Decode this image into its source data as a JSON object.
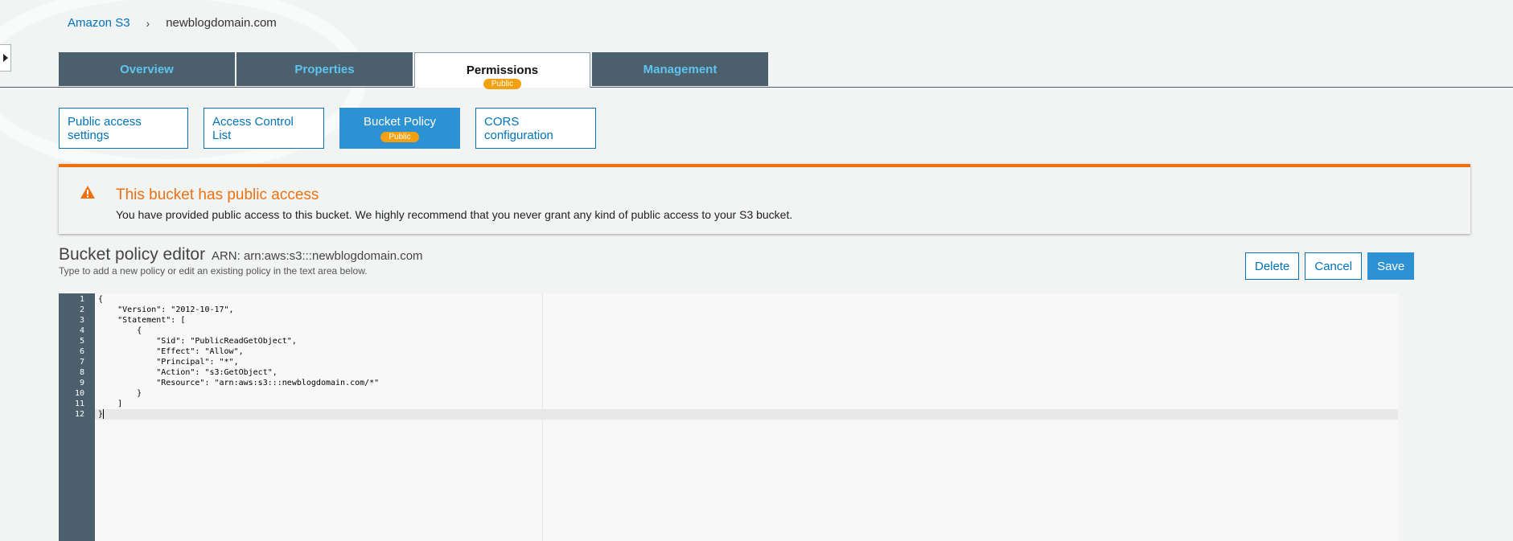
{
  "breadcrumb": {
    "root": "Amazon S3",
    "separator": "›",
    "current": "newblogdomain.com"
  },
  "tabs": [
    {
      "label": "Overview"
    },
    {
      "label": "Properties"
    },
    {
      "label": "Permissions",
      "badge": "Public"
    },
    {
      "label": "Management"
    }
  ],
  "subtabs": [
    {
      "label": "Public access settings"
    },
    {
      "label": "Access Control List"
    },
    {
      "label": "Bucket Policy",
      "badge": "Public"
    },
    {
      "label": "CORS configuration"
    }
  ],
  "alert": {
    "title": "This bucket has public access",
    "body": "You have provided public access to this bucket. We highly recommend that you never grant any kind of public access to your S3 bucket."
  },
  "editor": {
    "title": "Bucket policy editor",
    "arn": "ARN: arn:aws:s3:::newblogdomain.com",
    "hint": "Type to add a new policy or edit an existing policy in the text area below.",
    "line_numbers": [
      "1",
      "2",
      "3",
      "4",
      "5",
      "6",
      "7",
      "8",
      "9",
      "10",
      "11",
      "12"
    ],
    "lines": [
      "{",
      "    \"Version\": \"2012-10-17\",",
      "    \"Statement\": [",
      "        {",
      "            \"Sid\": \"PublicReadGetObject\",",
      "            \"Effect\": \"Allow\",",
      "            \"Principal\": \"*\",",
      "            \"Action\": \"s3:GetObject\",",
      "            \"Resource\": \"arn:aws:s3:::newblogdomain.com/*\"",
      "        }",
      "    ]",
      "}"
    ]
  },
  "actions": {
    "delete": "Delete",
    "cancel": "Cancel",
    "save": "Save"
  },
  "colors": {
    "accent": "#0073bb",
    "tab_bg": "#4b5f6d",
    "warning": "#ec7211",
    "badge": "#f5a00e"
  }
}
